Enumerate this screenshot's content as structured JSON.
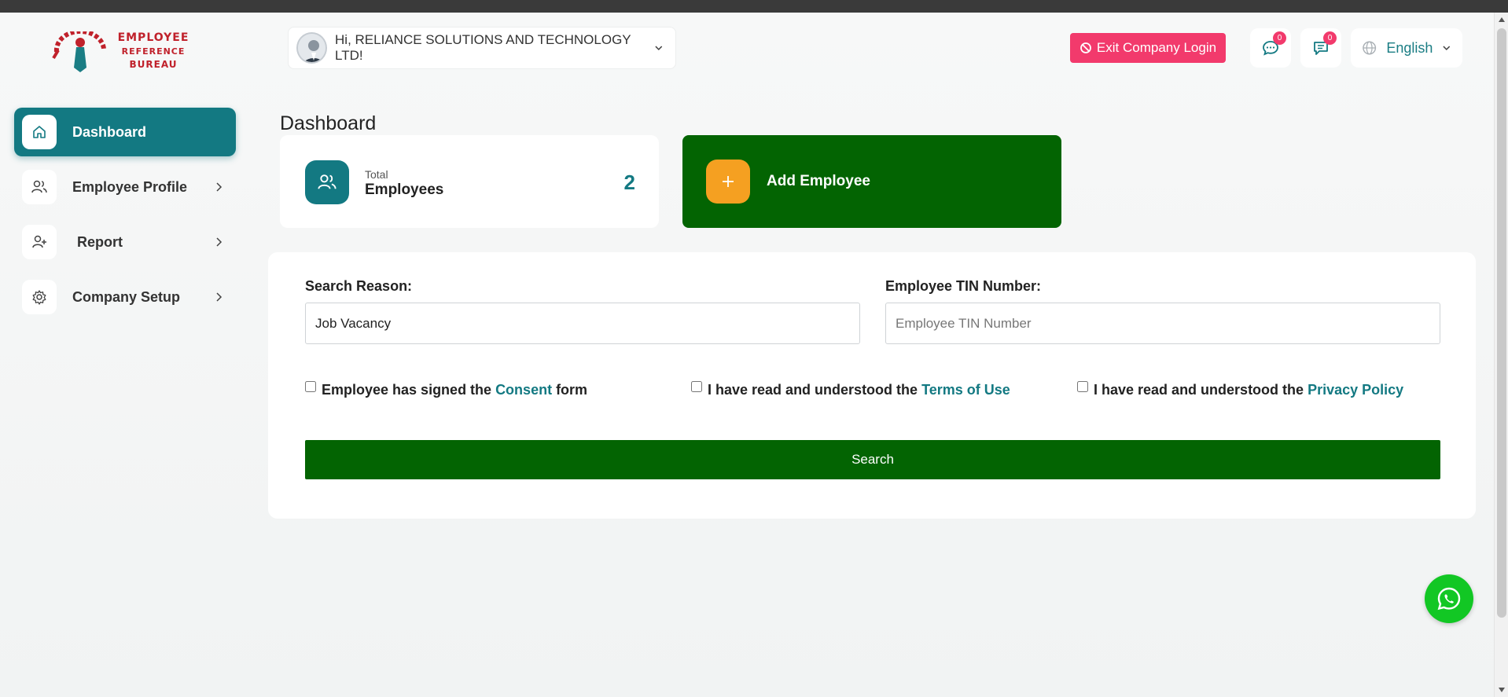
{
  "brand": {
    "line1": "EMPLOYEE",
    "line2": "REFERENCE",
    "line3": "BUREAU",
    "color": "#c0212b"
  },
  "header": {
    "greeting": "Hi, RELIANCE SOLUTIONS AND TECHNOLOGY LTD!",
    "exit_label": "Exit Company Login",
    "messages_badge": "0",
    "notifications_badge": "0",
    "language": "English"
  },
  "sidebar": {
    "items": [
      {
        "label": "Dashboard",
        "icon": "home-icon",
        "active": true
      },
      {
        "label": "Employee Profile",
        "icon": "users-icon",
        "active": false
      },
      {
        "label": "Report",
        "icon": "user-plus-icon",
        "active": false
      },
      {
        "label": "Company Setup",
        "icon": "gear-icon",
        "active": false
      }
    ]
  },
  "main": {
    "title": "Dashboard",
    "total_card": {
      "small": "Total",
      "label": "Employees",
      "value": "2"
    },
    "add_card": {
      "label": "Add Employee"
    }
  },
  "search_form": {
    "reason_label": "Search Reason:",
    "reason_value": "Job Vacancy",
    "tin_label": "Employee TIN Number:",
    "tin_placeholder": "Employee TIN Number",
    "consent": {
      "pre": "Employee has signed the ",
      "link": "Consent",
      "post": " form"
    },
    "terms": {
      "pre": "I have read and understood the ",
      "link": "Terms of Use"
    },
    "privacy": {
      "pre": "I have read and understood the ",
      "link": "Privacy Policy"
    },
    "search_label": "Search"
  },
  "colors": {
    "primary": "#137982",
    "green": "#036402",
    "accent_orange": "#f5a021",
    "exit_pink": "#f23a6c",
    "whatsapp": "#12c724"
  }
}
